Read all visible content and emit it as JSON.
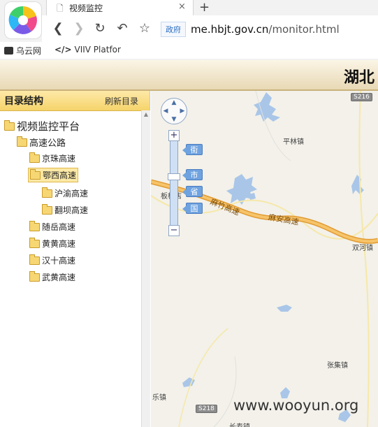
{
  "browser": {
    "tab_title": "视频监控",
    "tab_close": "×",
    "new_tab": "+",
    "gov_badge": "政府",
    "url_domain": "me.hbjt.gov.cn",
    "url_path": "/monitor.html",
    "bookmarks": [
      {
        "label": "乌云网"
      },
      {
        "label": "VIIV Platfor"
      }
    ]
  },
  "header": {
    "title": "湖北"
  },
  "sidebar": {
    "title": "目录结构",
    "refresh": "刷新目录",
    "tree": [
      {
        "label": "视频监控平台",
        "level": 0
      },
      {
        "label": "高速公路",
        "level": 1
      },
      {
        "label": "京珠高速",
        "level": 2
      },
      {
        "label": "鄂西高速",
        "level": 2,
        "selected": true
      },
      {
        "label": "沪渝高速",
        "level": 3
      },
      {
        "label": "翻坝高速",
        "level": 3
      },
      {
        "label": "随岳高速",
        "level": 2
      },
      {
        "label": "黄黄高速",
        "level": 2
      },
      {
        "label": "汉十高速",
        "level": 2
      },
      {
        "label": "武黄高速",
        "level": 2
      }
    ]
  },
  "map": {
    "zoom_in": "+",
    "zoom_out": "−",
    "levels": [
      "街",
      "市",
      "省",
      "国"
    ],
    "places": [
      "平林镇",
      "板桥店",
      "双河镇",
      "张集镇",
      "乐镇",
      "长寿镇"
    ],
    "roads": [
      "麻竹高速",
      "麻安高速"
    ],
    "shields": [
      "S216",
      "S218"
    ],
    "watermark": "www.wooyun.org"
  },
  "colors": {
    "highway": "#f0b24a",
    "water": "#a9c6e8",
    "map_bg": "#f3f1ea",
    "sidebar_header": "#f6d46b"
  }
}
